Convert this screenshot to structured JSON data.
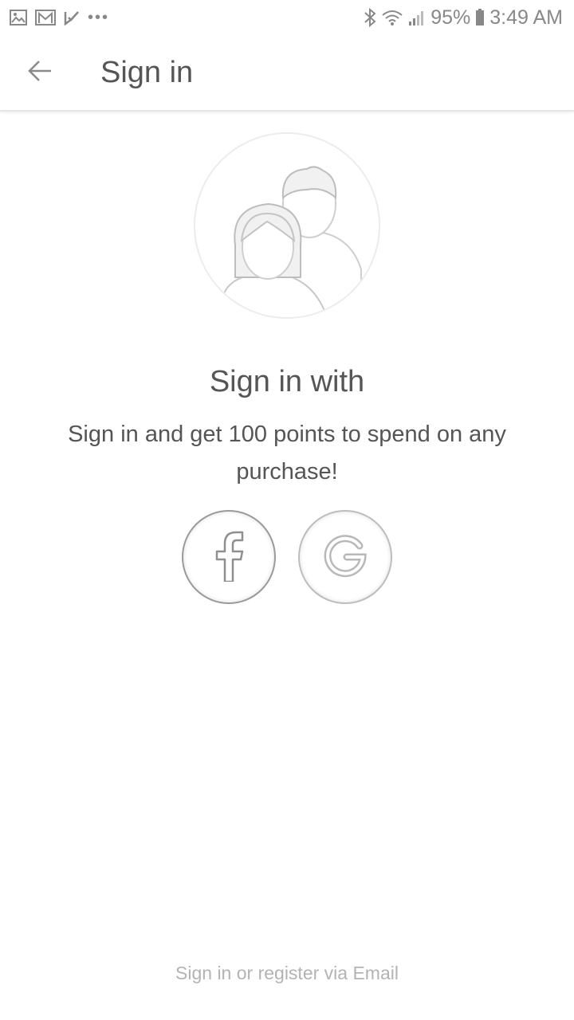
{
  "status_bar": {
    "notification_icons": [
      "gallery-icon",
      "gmail-icon",
      "check-icon",
      "more-icon"
    ],
    "more_label": "•••",
    "battery_percent": "95%",
    "time": "3:49 AM"
  },
  "app_bar": {
    "title": "Sign in",
    "back_icon": "arrow-left-icon"
  },
  "main": {
    "avatar_icon": "users-icon",
    "heading": "Sign in with",
    "subtitle": "Sign in and get 100 points to spend on any purchase!",
    "social_buttons": [
      {
        "icon": "facebook-icon",
        "glyph": "f"
      },
      {
        "icon": "google-icon",
        "glyph": "G"
      }
    ]
  },
  "footer": {
    "email_link": "Sign in or register via Email"
  },
  "colors": {
    "text": "#555555",
    "muted": "#b3b3b3",
    "divider": "#e6e6e6"
  }
}
